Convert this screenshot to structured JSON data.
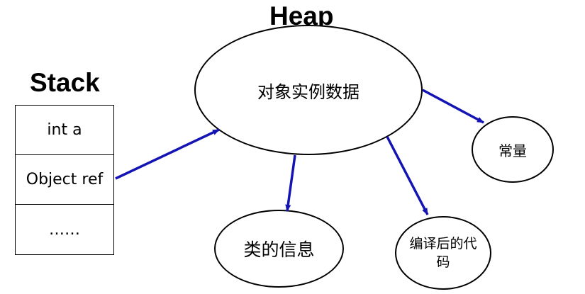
{
  "stack": {
    "title": "Stack",
    "cells": [
      "int a",
      "Object ref",
      "……"
    ]
  },
  "heap": {
    "title": "Heap",
    "center_label": "对象实例数据"
  },
  "nodes": {
    "constants": "常量",
    "class_info": "类的信息",
    "compiled_code": "编译后的代码"
  },
  "colors": {
    "arrow": "#1414b4",
    "line": "#000000"
  }
}
